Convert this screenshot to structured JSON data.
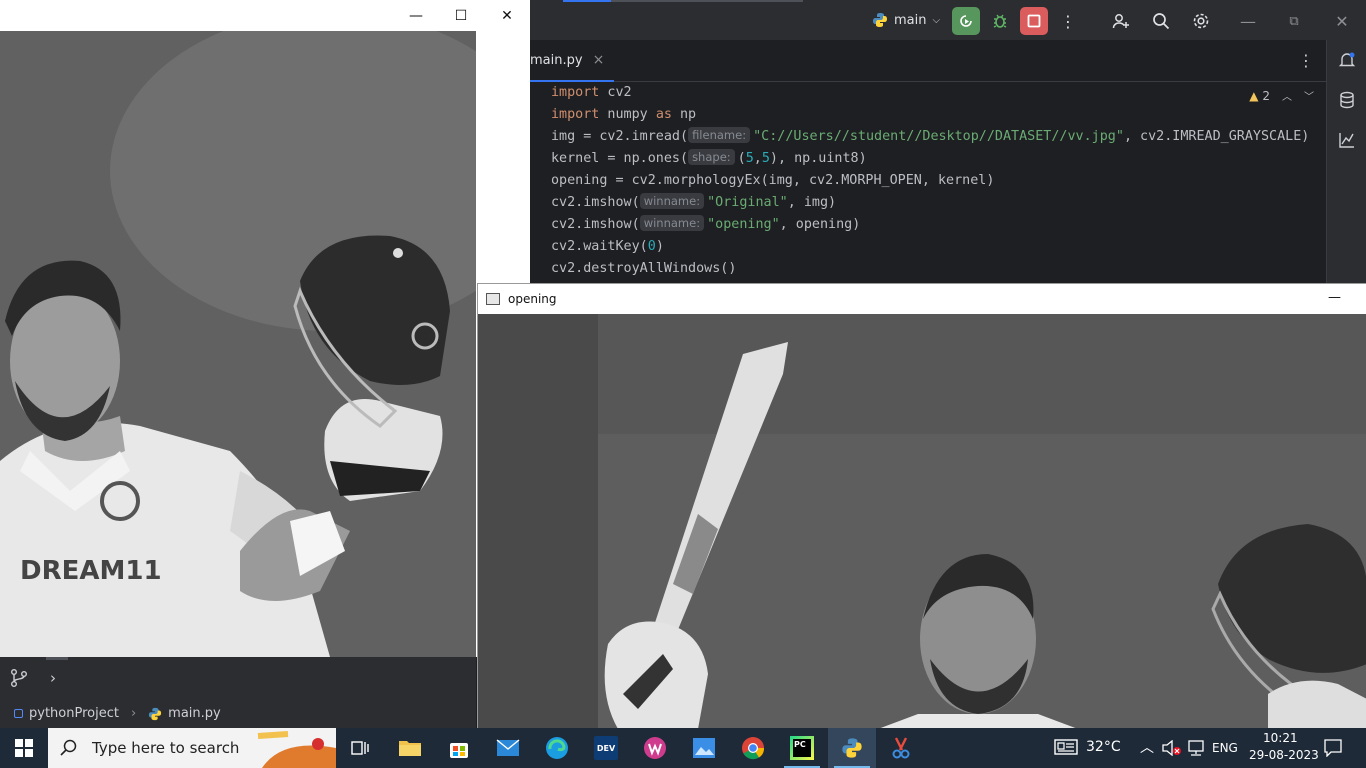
{
  "ide": {
    "branch": "main",
    "tab": {
      "label": "main.py",
      "close": "×"
    },
    "warnings_count": "2",
    "run_progress": 0.2,
    "code": {
      "l1": {
        "kw": "import",
        "rest": " cv2"
      },
      "l2": {
        "kw1": "import",
        "mid": " numpy ",
        "kw2": "as",
        "rest": " np"
      },
      "l3": {
        "pre": "img = cv2.imread(",
        "hint": "filename:",
        "str": "\"C://Users//student//Desktop//DATASET//vv.jpg\"",
        "post": ", cv2.IMREAD_GRAYSCALE)"
      },
      "l4": {
        "pre": "kernel = np.ones(",
        "hint": "shape:",
        "open": "(",
        "n1": "5",
        "comma": ",",
        "n2": "5",
        "post": "), np.uint8)"
      },
      "l5": {
        "text": "opening = cv2.morphologyEx(img, cv2.MORPH_OPEN, kernel)"
      },
      "l6": {
        "pre": "cv2.imshow(",
        "hint": "winname:",
        "str": "\"Original\"",
        "post": ", img)"
      },
      "l7": {
        "pre": "cv2.imshow(",
        "hint": "winname:",
        "str": "\"opening\"",
        "post": ", opening)"
      },
      "l8": {
        "pre": "cv2.waitKey(",
        "num": "0",
        "post": ")"
      },
      "l9": {
        "text": "cv2.destroyAllWindows()"
      }
    },
    "breadcrumb": {
      "project": "pythonProject",
      "sep": "›",
      "file": "main.py"
    },
    "expand_chevron": "›"
  },
  "windows": {
    "original": {
      "minimize": "—",
      "maximize": "☐",
      "close": "✕"
    },
    "opening": {
      "title": "opening",
      "minimize": "—"
    }
  },
  "photo_text": {
    "jersey_sponsor": "DREAM11"
  },
  "taskbar": {
    "search_placeholder": "Type here to search",
    "weather": "32°C",
    "language": "ENG",
    "time": "10:21",
    "date": "29-08-2023",
    "dev_label": "DEV",
    "pc_label": "PC"
  },
  "colors": {
    "ide_bg": "#1e1f22",
    "accent": "#3574f0",
    "run_green": "#5fb865",
    "stop_red": "#db5c5c",
    "taskbar": "#1f2a38"
  }
}
